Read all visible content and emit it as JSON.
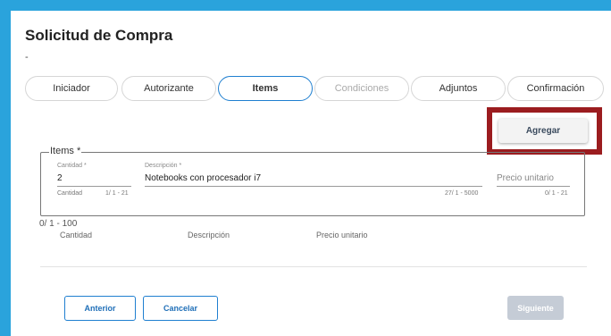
{
  "page": {
    "title": "Solicitud de Compra",
    "subtitle": "-"
  },
  "tabs": [
    {
      "label": "Iniciador",
      "state": "done"
    },
    {
      "label": "Autorizante",
      "state": "done"
    },
    {
      "label": "Items",
      "state": "active"
    },
    {
      "label": "Condiciones",
      "state": "disabled"
    },
    {
      "label": "Adjuntos",
      "state": "done"
    },
    {
      "label": "Confirmación",
      "state": "done"
    }
  ],
  "toolbar": {
    "add_label": "Agregar"
  },
  "items_form": {
    "legend": "Items *",
    "quantity": {
      "label": "Cantidad *",
      "value": "2",
      "hint_left": "Cantidad",
      "hint_right": "1/ 1 - 21"
    },
    "description": {
      "label": "Descripción *",
      "value": "Notebooks con procesador i7",
      "hint_right": "27/ 1 - 5000"
    },
    "unit_price": {
      "placeholder": "Precio unitario",
      "hint_right": "0/ 1 - 21"
    }
  },
  "items_table": {
    "counter": "0/ 1 - 100",
    "columns": [
      "Cantidad",
      "Descripción",
      "Precio unitario"
    ]
  },
  "footer": {
    "back_label": "Anterior",
    "cancel_label": "Cancelar",
    "next_label": "Siguiente"
  },
  "colors": {
    "background": "#2aa3dc",
    "accent": "#1f7fd0",
    "highlight": "#9b1c1f",
    "disabled_button": "#c5ccd6"
  }
}
